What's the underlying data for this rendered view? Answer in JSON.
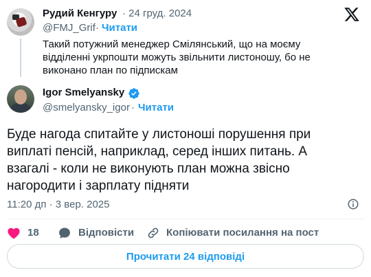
{
  "parent": {
    "name": "Рудий Кенгуру",
    "date": "· 24 груд. 2024",
    "handle": "@FMJ_Grif",
    "dot": "·",
    "follow": "Читати",
    "text": "Такий потужний менеджер Смілянський, що на моєму відділенні укрпошти можуть звільнити листоношу, бо не виконано план по підпискам"
  },
  "main": {
    "name": "Igor Smelyansky",
    "verified_icon": "verified-badge-icon",
    "handle": "@smelyansky_igor",
    "dot": "·",
    "follow": "Читати",
    "text": "Буде нагода спитайте у листоноші порушення при виплаті пенсій, наприклад, серед інших питань. А взагалі - коли не виконують план можна звісно нагородити і зарплату підняти",
    "timestamp": "11:20 дп · 3 вер. 2025"
  },
  "actions": {
    "like_count": "18",
    "reply_label": "Відповісти",
    "copy_link_label": "Копіювати посилання на пост"
  },
  "read_replies_label": "Прочитати 24 відповіді",
  "colors": {
    "accent": "#1d9bf0",
    "like": "#f91880",
    "muted": "#536471",
    "text": "#0f1419"
  }
}
